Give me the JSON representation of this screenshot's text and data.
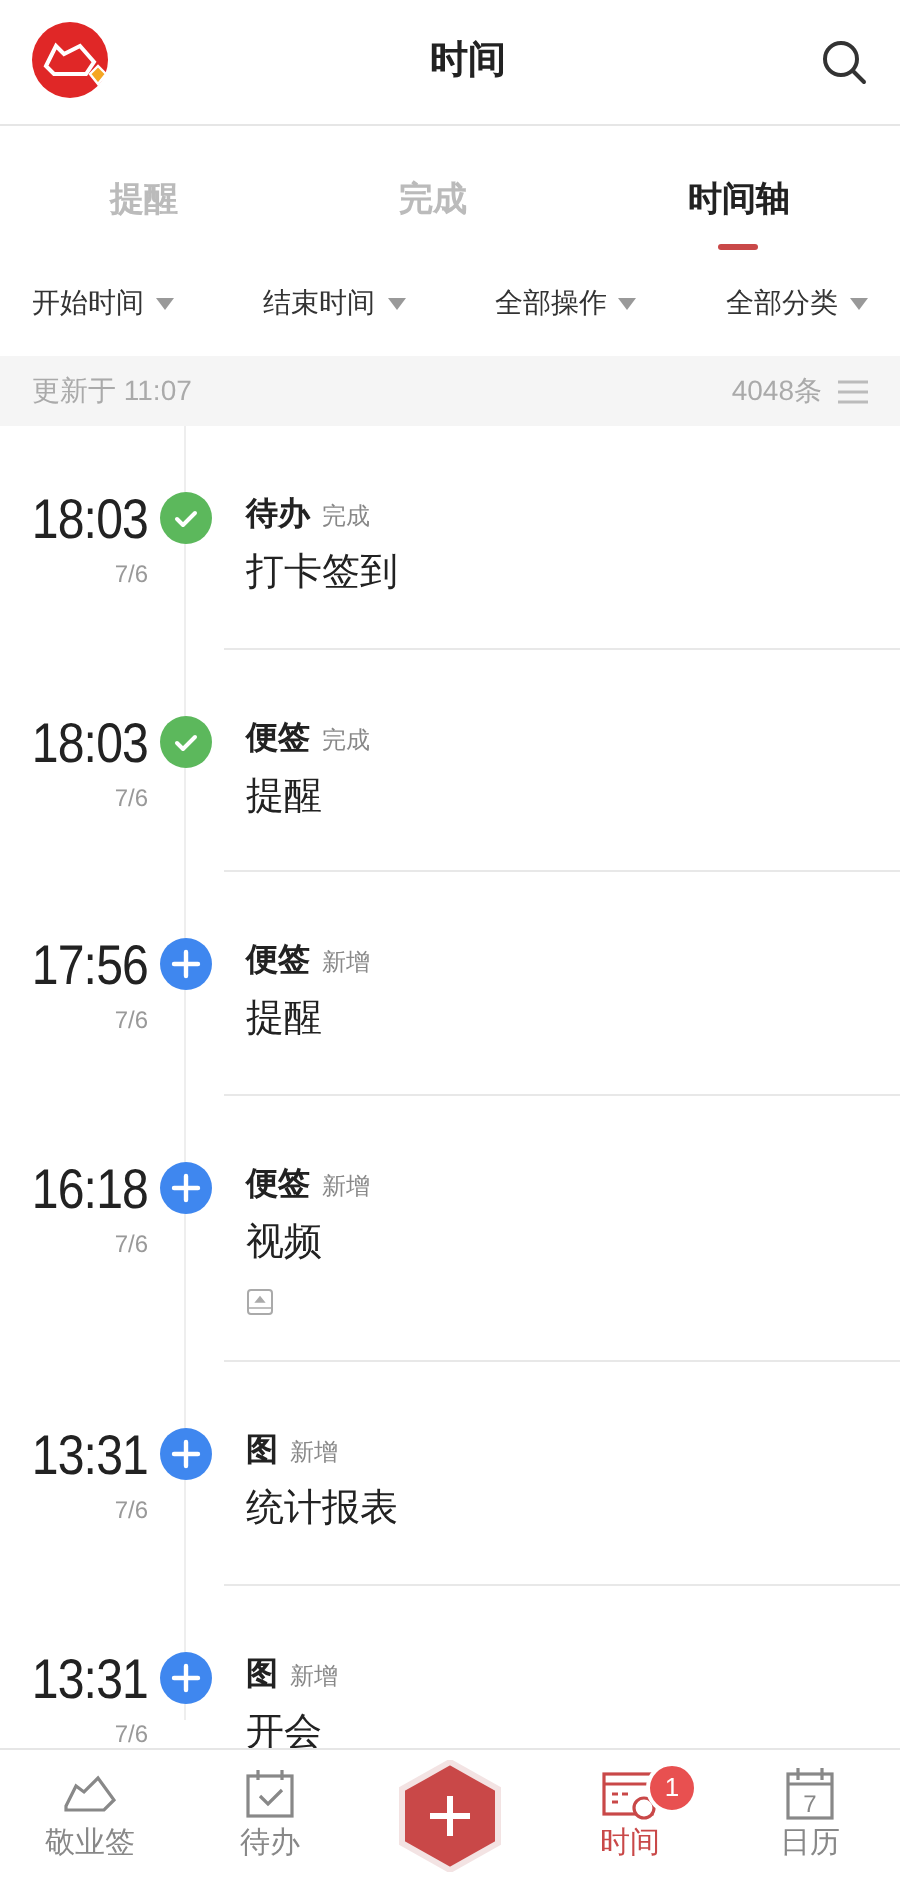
{
  "header": {
    "title": "时间"
  },
  "tabs": [
    {
      "label": "提醒",
      "selected": false
    },
    {
      "label": "完成",
      "selected": false
    },
    {
      "label": "时间轴",
      "selected": true
    }
  ],
  "filters": [
    "开始时间",
    "结束时间",
    "全部操作",
    "全部分类"
  ],
  "status_bar": {
    "updated": "更新于 11:07",
    "count": "4048条"
  },
  "timeline": [
    {
      "time": "18:03",
      "date": "7/6",
      "kind": "done",
      "category": "待办",
      "action": "完成",
      "title": "打卡签到",
      "attachment": false
    },
    {
      "time": "18:03",
      "date": "7/6",
      "kind": "done",
      "category": "便签",
      "action": "完成",
      "title": "提醒",
      "attachment": false
    },
    {
      "time": "17:56",
      "date": "7/6",
      "kind": "add",
      "category": "便签",
      "action": "新增",
      "title": "提醒",
      "attachment": false
    },
    {
      "time": "16:18",
      "date": "7/6",
      "kind": "add",
      "category": "便签",
      "action": "新增",
      "title": "视频",
      "attachment": true
    },
    {
      "time": "13:31",
      "date": "7/6",
      "kind": "add",
      "category": "图",
      "action": "新增",
      "title": "统计报表",
      "attachment": false
    },
    {
      "time": "13:31",
      "date": "7/6",
      "kind": "add",
      "category": "图",
      "action": "新增",
      "title": "开会",
      "attachment": false
    }
  ],
  "bottom_nav": [
    {
      "kind": "notes",
      "label": "敬业签",
      "selected": false
    },
    {
      "kind": "todo",
      "label": "待办",
      "selected": false
    },
    {
      "kind": "add"
    },
    {
      "kind": "time",
      "label": "时间",
      "selected": true,
      "badge": "1"
    },
    {
      "kind": "calendar",
      "label": "日历",
      "selected": false,
      "icon_text": "7"
    }
  ]
}
